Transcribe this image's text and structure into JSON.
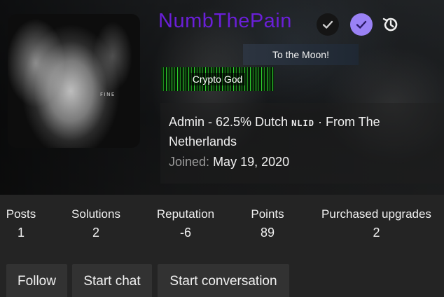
{
  "profile": {
    "username": "NumbThePain",
    "avatar_caption": "FINE",
    "user_title": "To the Moon!",
    "banner_label": "Crypto God",
    "role_line_prefix": "Admin - 62.5% Dutch ",
    "country_code": "NLID",
    "role_line_suffix": " · From The Netherlands",
    "joined_label": "Joined:",
    "joined_date": "May 19, 2020"
  },
  "badges": [
    {
      "icon": "check-circle-dark-icon"
    },
    {
      "icon": "check-circle-verified-icon",
      "color": "#9a82f5"
    },
    {
      "icon": "history-icon"
    }
  ],
  "stats": [
    {
      "label": "Posts",
      "value": "1"
    },
    {
      "label": "Solutions",
      "value": "2"
    },
    {
      "label": "Reputation",
      "value": "-6"
    },
    {
      "label": "Points",
      "value": "89"
    },
    {
      "label": "Purchased upgrades",
      "value": "2"
    }
  ],
  "actions": {
    "follow": "Follow",
    "start_chat": "Start chat",
    "start_conversation": "Start conversation"
  },
  "colors": {
    "username": "#6a1fd8",
    "background": "#242424",
    "button": "#323232"
  }
}
